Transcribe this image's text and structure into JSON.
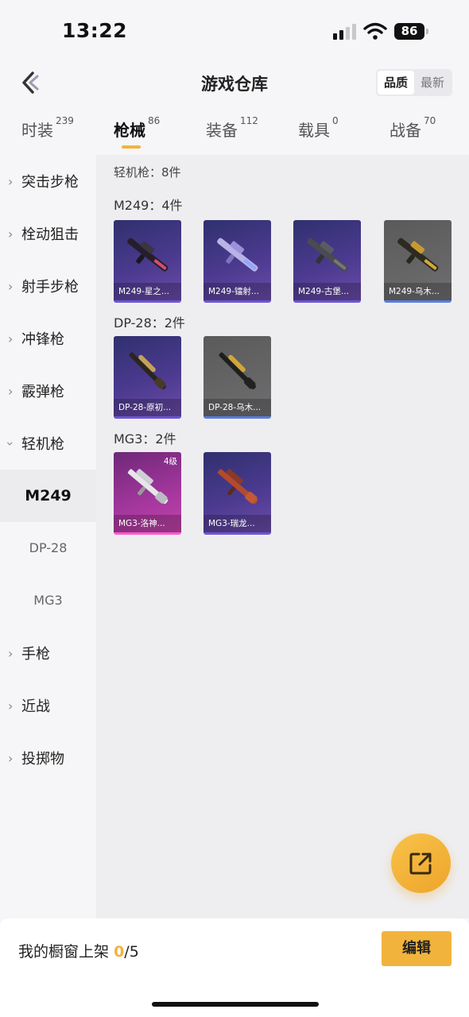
{
  "status_bar": {
    "time": "13:22",
    "battery": "86"
  },
  "header": {
    "title": "游戏仓库",
    "sort_options": [
      "品质",
      "最新"
    ]
  },
  "tabs": [
    {
      "label": "时装",
      "count": "239"
    },
    {
      "label": "枪械",
      "count": "86"
    },
    {
      "label": "装备",
      "count": "112"
    },
    {
      "label": "载具",
      "count": "0"
    },
    {
      "label": "战备",
      "count": "70"
    }
  ],
  "sidebar": {
    "categories": [
      {
        "label": "突击步枪"
      },
      {
        "label": "栓动狙击"
      },
      {
        "label": "射手步枪"
      },
      {
        "label": "冲锋枪"
      },
      {
        "label": "霰弹枪"
      },
      {
        "label": "轻机枪"
      }
    ],
    "subitems": [
      {
        "label": "M249"
      },
      {
        "label": "DP-28"
      },
      {
        "label": "MG3"
      }
    ],
    "categories_after": [
      {
        "label": "手枪"
      },
      {
        "label": "近战"
      },
      {
        "label": "投掷物"
      }
    ]
  },
  "content": {
    "total": "轻机枪：8件",
    "groups": [
      {
        "label": "M249：4件",
        "items": [
          {
            "name": "M249-星之...",
            "rarity": "purple"
          },
          {
            "name": "M249-镭射...",
            "rarity": "purple"
          },
          {
            "name": "M249-古堡...",
            "rarity": "purple"
          },
          {
            "name": "M249-乌木...",
            "rarity": "grey"
          }
        ]
      },
      {
        "label": "DP-28：2件",
        "items": [
          {
            "name": "DP-28-原初...",
            "rarity": "purple"
          },
          {
            "name": "DP-28-乌木...",
            "rarity": "grey"
          }
        ]
      },
      {
        "label": "MG3：2件",
        "items": [
          {
            "name": "MG3-洛神...",
            "rarity": "pink",
            "level": "4级"
          },
          {
            "name": "MG3-瑞龙...",
            "rarity": "purple"
          }
        ]
      }
    ]
  },
  "bottom": {
    "shelf_label": "我的橱窗上架",
    "shelf_current": "0",
    "shelf_total": "/5",
    "edit_label": "编辑"
  },
  "icons": [
    "back-icon",
    "signal-icon",
    "wifi-icon",
    "battery-icon",
    "share-icon",
    "chevron-right-icon",
    "chevron-down-icon"
  ],
  "colors": {
    "accent": "#f2b33d",
    "purple_card": "#4b3a8f",
    "grey_card": "#6e6e70",
    "pink_card": "#a5379e"
  }
}
